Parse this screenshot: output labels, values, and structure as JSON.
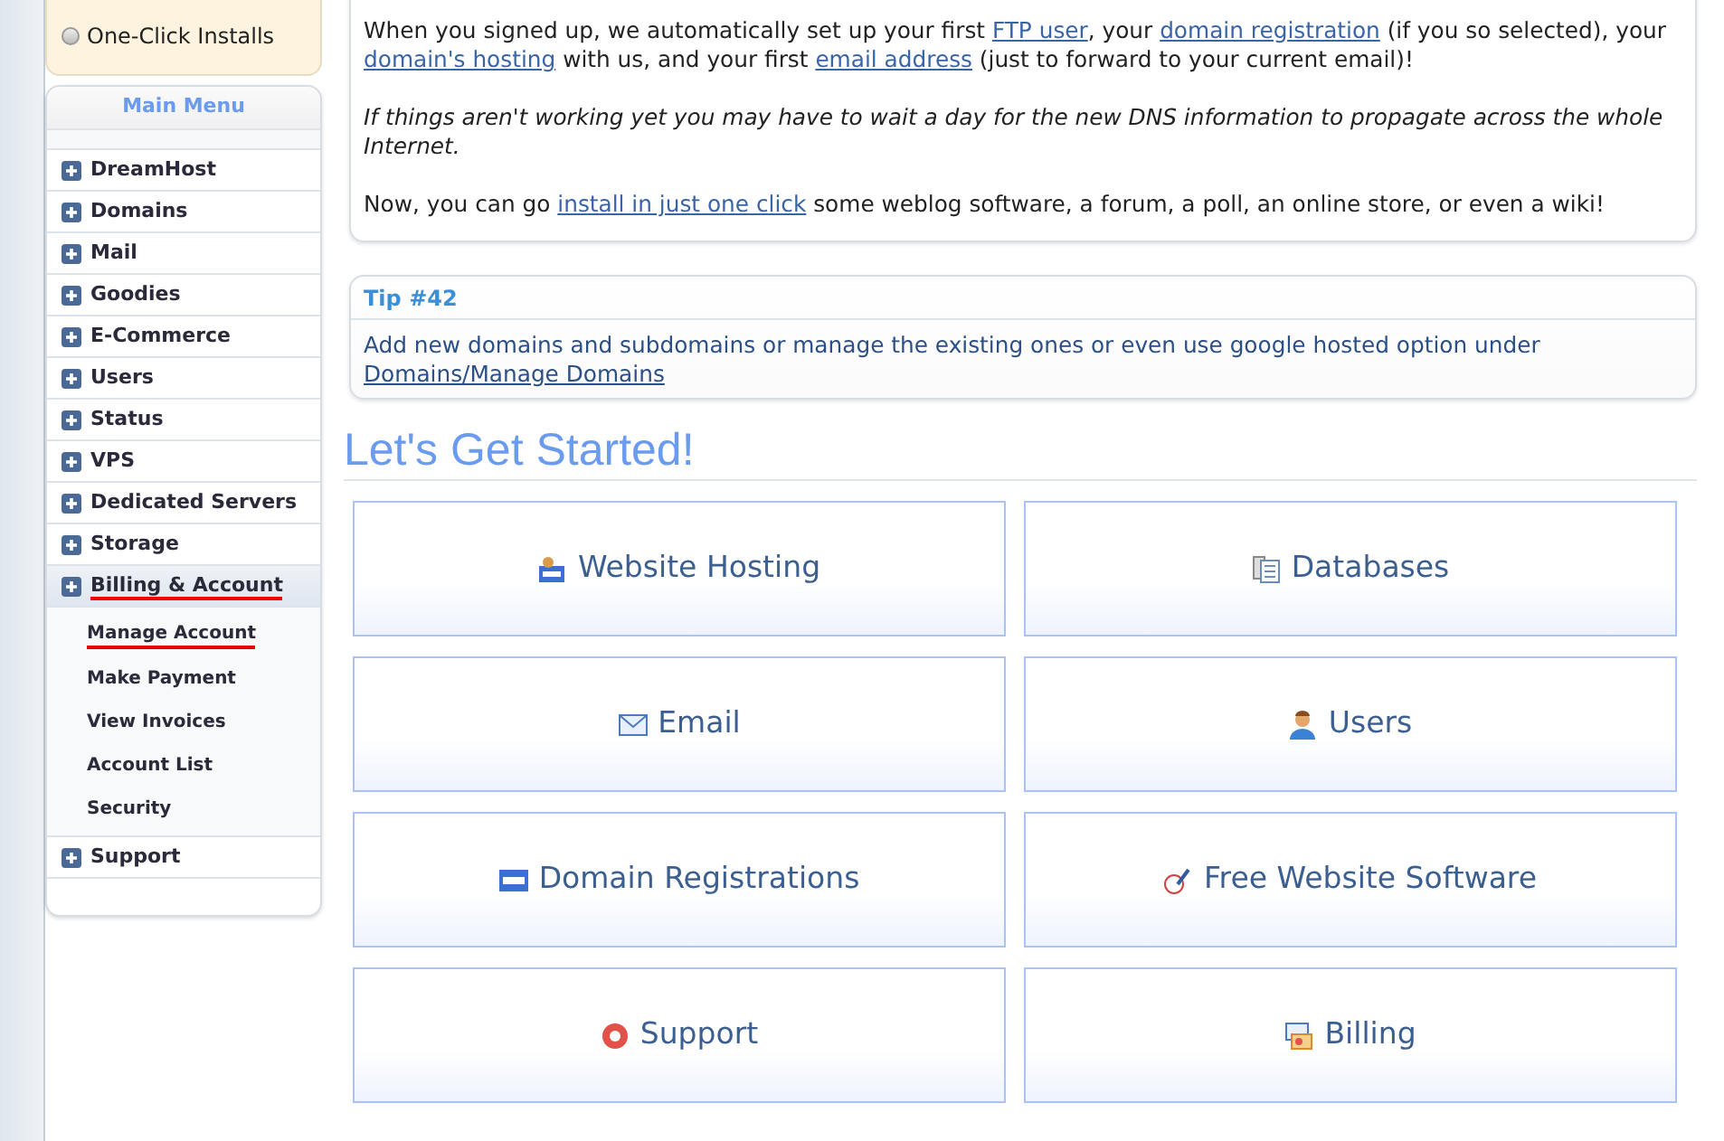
{
  "top_panel": {
    "items": [
      {
        "label": "One-Click Installs",
        "selected": false
      }
    ]
  },
  "main_menu": {
    "title": "Main Menu",
    "items": [
      {
        "label": "DreamHost",
        "expanded": false
      },
      {
        "label": "Domains",
        "expanded": false
      },
      {
        "label": "Mail",
        "expanded": false
      },
      {
        "label": "Goodies",
        "expanded": false
      },
      {
        "label": "E-Commerce",
        "expanded": false
      },
      {
        "label": "Users",
        "expanded": false
      },
      {
        "label": "Status",
        "expanded": false
      },
      {
        "label": "VPS",
        "expanded": false
      },
      {
        "label": "Dedicated Servers",
        "expanded": false
      },
      {
        "label": "Storage",
        "expanded": false
      },
      {
        "label": "Billing & Account",
        "expanded": true,
        "children": [
          {
            "label": "Manage Account",
            "selected": true
          },
          {
            "label": "Make Payment",
            "selected": false
          },
          {
            "label": "View Invoices",
            "selected": false
          },
          {
            "label": "Account List",
            "selected": false
          },
          {
            "label": "Security",
            "selected": false
          }
        ]
      },
      {
        "label": "Support",
        "expanded": false
      }
    ]
  },
  "intro": {
    "paragraphs": [
      {
        "italic": false,
        "parts": [
          {
            "kind": "text",
            "text": "When you signed up, we automatically set up your first "
          },
          {
            "kind": "link",
            "text": "FTP user"
          },
          {
            "kind": "text",
            "text": ", your "
          },
          {
            "kind": "link",
            "text": "domain registration"
          },
          {
            "kind": "text",
            "text": " (if you so selected), your "
          },
          {
            "kind": "link",
            "text": "domain's hosting"
          },
          {
            "kind": "text",
            "text": " with us, and your first "
          },
          {
            "kind": "link",
            "text": "email address"
          },
          {
            "kind": "text",
            "text": " (just to forward to your current email)!"
          }
        ]
      },
      {
        "italic": true,
        "parts": [
          {
            "kind": "text",
            "text": "If things aren't working yet you may have to wait a day for the new DNS information to propagate across the whole Internet."
          }
        ]
      },
      {
        "italic": false,
        "parts": [
          {
            "kind": "text",
            "text": "Now, you can go "
          },
          {
            "kind": "link",
            "text": "install in just one click"
          },
          {
            "kind": "text",
            "text": " some weblog software, a forum, a poll, an online store, or even a wiki!"
          }
        ]
      }
    ]
  },
  "tip": {
    "title": "Tip #42",
    "text": "Add new domains and subdomains or manage the existing ones or even use google hosted option under",
    "link": "Domains/Manage Domains"
  },
  "heading": "Let's Get Started!",
  "tiles": [
    {
      "kind": "hosting",
      "label": "Website Hosting"
    },
    {
      "kind": "databases",
      "label": "Databases"
    },
    {
      "kind": "email",
      "label": "Email"
    },
    {
      "kind": "users",
      "label": "Users"
    },
    {
      "kind": "domains",
      "label": "Domain Registrations"
    },
    {
      "kind": "software",
      "label": "Free Website Software"
    },
    {
      "kind": "support",
      "label": "Support"
    },
    {
      "kind": "billing",
      "label": "Billing"
    }
  ]
}
